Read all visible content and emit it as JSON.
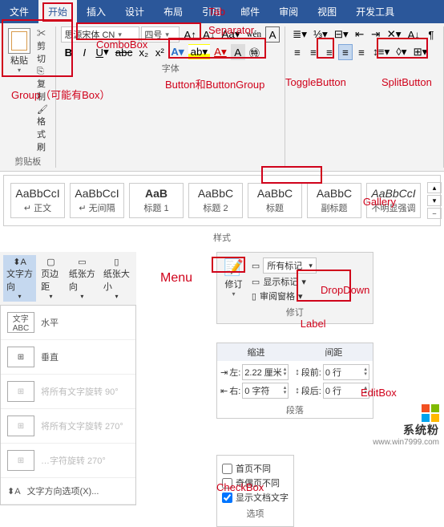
{
  "tabs": [
    "文件",
    "开始",
    "插入",
    "设计",
    "布局",
    "引用",
    "邮件",
    "审阅",
    "视图",
    "开发工具"
  ],
  "active_tab_index": 1,
  "clipboard": {
    "paste": "粘贴",
    "cut": "剪切",
    "copy": "复制",
    "format_painter": "格式刷",
    "group": "剪贴板"
  },
  "font": {
    "name": "思源宋体 CN",
    "size": "四号",
    "group": "字体"
  },
  "styles_group": "样式",
  "gallery": [
    {
      "preview": "AaBbCcI",
      "caption": "↵ 正文"
    },
    {
      "preview": "AaBbCcI",
      "caption": "↵ 无间隔"
    },
    {
      "preview": "AaB",
      "caption": "标题 1",
      "bold": true
    },
    {
      "preview": "AaBbC",
      "caption": "标题 2"
    },
    {
      "preview": "AaBbC",
      "caption": "标题"
    },
    {
      "preview": "AaBbC",
      "caption": "副标题"
    },
    {
      "preview": "AaBbCcI",
      "caption": "不明显强调",
      "italic": true
    }
  ],
  "menu": {
    "header_items": [
      "文字方向",
      "页边距",
      "纸张方向",
      "纸张大小"
    ],
    "active": "文字方向",
    "items": [
      {
        "icon": "文字\nABC",
        "label": "水平"
      },
      {
        "icon": "⊞",
        "label": "垂直"
      },
      {
        "icon": "⊞",
        "label": "将所有文字旋转 90°",
        "disabled": true
      },
      {
        "icon": "⊞",
        "label": "将所有文字旋转 270°",
        "disabled": true
      },
      {
        "icon": "⊞",
        "label": "…字符旋转 270°",
        "disabled": true
      }
    ],
    "footer": "文字方向选项(X)..."
  },
  "dropdown": {
    "all_marks": "所有标记",
    "show_marks": "显示标记",
    "review_pane": "审阅窗格",
    "big": "修订",
    "group": "修订"
  },
  "label_section": {
    "indent": "缩进",
    "spacing": "间距",
    "left_label": "左:",
    "left_val": "2.22 厘米",
    "right_label": "右:",
    "right_val": "0 字符",
    "before_label": "段前:",
    "before_val": "0 行",
    "after_label": "段后:",
    "after_val": "0 行",
    "group": "段落"
  },
  "checks": {
    "first": "首页不同",
    "odd": "奇偶页不同",
    "doc": "显示文档文字",
    "group": "选项"
  },
  "annotations": {
    "tab": "Tab",
    "separator": "Separator",
    "combobox": "ComboBox",
    "button_group": "Button和ButtonGroup",
    "toggle": "ToggleButton",
    "split": "SplitButton",
    "group": "Group（可能有Box）",
    "gallery": "Gallery",
    "menu": "Menu",
    "dropdown": "DropDown",
    "label": "Label",
    "editbox": "EditBox",
    "checkbox": "CheckBox"
  },
  "watermark": {
    "name": "系统粉",
    "url": "www.win7999.com"
  }
}
